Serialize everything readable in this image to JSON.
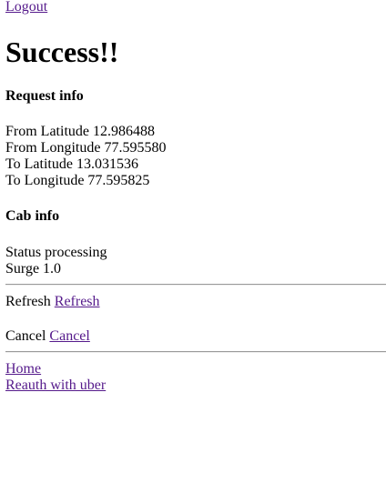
{
  "header": {
    "logout_link": "Logout",
    "title": "Success!!"
  },
  "request_info": {
    "heading": "Request info",
    "from_latitude_label": "From Latitude",
    "from_latitude_value": "12.986488",
    "from_longitude_label": "From Longitude",
    "from_longitude_value": "77.595580",
    "to_latitude_label": "To Latitude",
    "to_latitude_value": "13.031536",
    "to_longitude_label": "To Longitude",
    "to_longitude_value": "77.595825"
  },
  "cab_info": {
    "heading": "Cab info",
    "status_label": "Status",
    "status_value": "processing",
    "surge_label": "Surge",
    "surge_value": "1.0"
  },
  "actions": {
    "refresh_label": "Refresh",
    "refresh_link": "Refresh",
    "cancel_label": "Cancel",
    "cancel_link": "Cancel"
  },
  "footer": {
    "home_link": "Home",
    "reauth_link": "Reauth with uber"
  },
  "colors": {
    "link": "#551a8b",
    "text": "#000000",
    "background": "#ffffff"
  }
}
